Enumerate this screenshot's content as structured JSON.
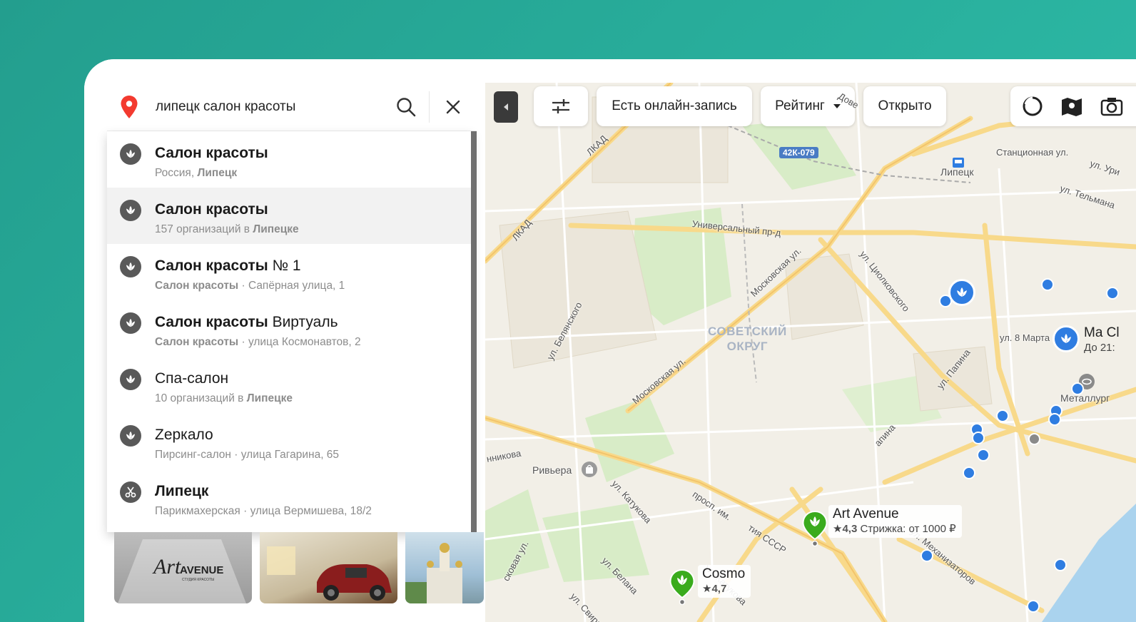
{
  "search": {
    "query": "липецк салон красоты"
  },
  "suggestions": [
    {
      "title_bold": "Салон красоты",
      "title_rest": "",
      "sub_plain": "Россия, ",
      "sub_bold": "Липецк",
      "icon": "lotus-icon",
      "active": false
    },
    {
      "title_bold": "Салон красоты",
      "title_rest": "",
      "sub_plain": "157 организаций в ",
      "sub_bold": "Липецке",
      "icon": "lotus-icon",
      "active": true
    },
    {
      "title_bold": "Салон красоты",
      "title_rest": " № 1",
      "sub_bold_first": "Салон красоты",
      "sub_plain": " · Сапёрная улица, 1",
      "icon": "lotus-icon"
    },
    {
      "title_bold": "Салон красоты",
      "title_rest": " Виртуаль",
      "sub_bold_first": "Салон красоты",
      "sub_plain": " · улица Космонавтов, 2",
      "icon": "lotus-icon"
    },
    {
      "title_bold": "",
      "title_rest": "Спа-салон",
      "sub_plain": "10 организаций в ",
      "sub_bold": "Липецке",
      "icon": "lotus-icon"
    },
    {
      "title_bold": "",
      "title_rest": "Zеркало",
      "sub_plain": "Пирсинг-салон · улица Гагарина, 65",
      "icon": "lotus-icon"
    },
    {
      "title_bold": "Липецк",
      "title_rest": "",
      "sub_plain": "Парикмахерская · улица Вермишева, 18/2",
      "icon": "scissors-icon"
    }
  ],
  "toolbar": {
    "online_label": "Есть онлайн-запись",
    "rating_label": "Рейтинг",
    "open_label": "Открыто"
  },
  "map": {
    "labels": {
      "lipetsk": "Липецк",
      "stanc": "Станционная ул.",
      "univ": "Универсальный пр-д",
      "belansk": "ул. Белянского",
      "district_1": "СОВЕТСКИЙ",
      "district_2": "ОКРУГ",
      "metallurg": "Металлург",
      "riviera": "Ривьера",
      "march8": "ул. 8 Марта",
      "lkad1": "ЛКАД",
      "lkad2": "ЛКАД",
      "moskovskaya1": "Московская ул.",
      "moskovskaya2": "Московская ул.",
      "ciolk": "ул. Циолковского",
      "papina": "ул. Папина",
      "katukova1": "ул. Катукова",
      "katukova2": "ул. Катукова",
      "belana": "ул. Белана",
      "mechan": "ул. Механизаторов",
      "svird": "ул. Свиридова",
      "tel": "ул. Тельмана",
      "uri": "ул. Ури",
      "kovaya": "сковая ул.",
      "nnikova": "нникова",
      "prosp": "просп. им.",
      "ssr": "тия СССР",
      "papina2": "апина",
      "dove": "Дове"
    },
    "highway": "42К-079",
    "pins": {
      "art_name": "Art Avenue",
      "art_rating": "4,3",
      "art_extra": "Стрижка: от 1000 ₽",
      "cosmo_name": "Cosmo",
      "cosmo_rating": "4,7",
      "side_name": "Ma Cl",
      "side_sub": "До 21:"
    }
  },
  "photos": {
    "logo_text": "ART AVENUE",
    "logo_sub": "СТУДИЯ КРАСОТЫ"
  },
  "colors": {
    "background": "#2ab3a0",
    "pin_red": "#f33a2f",
    "poi_blue": "#2f7de1",
    "pin_green": "#3aab1d"
  }
}
